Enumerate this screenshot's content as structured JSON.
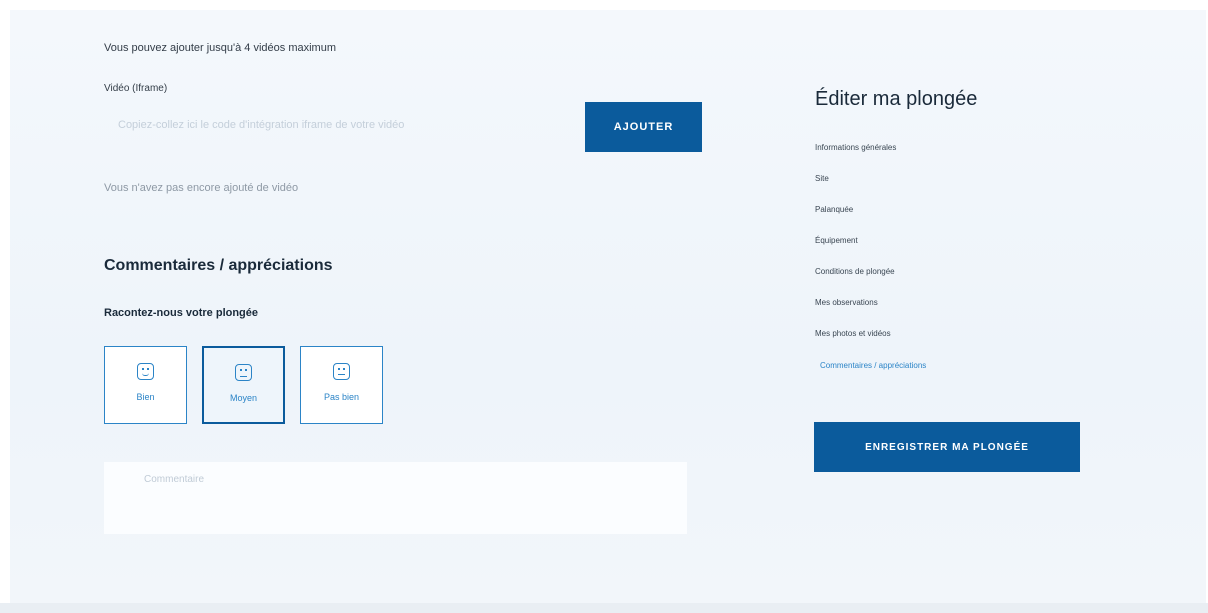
{
  "videos": {
    "limit_text": "Vous pouvez ajouter jusqu'à 4 vidéos maximum",
    "field_label": "Vidéo (Iframe)",
    "input_placeholder": "Copiez-collez ici le code d'intégration iframe de votre vidéo",
    "add_label": "AJOUTER",
    "empty_text": "Vous n'avez pas encore ajouté de vidéo"
  },
  "comments": {
    "section_title": "Commentaires / appréciations",
    "prompt": "Racontez-nous votre plongée",
    "ratings": [
      {
        "label": "Bien",
        "icon": "happy-face-icon"
      },
      {
        "label": "Moyen",
        "icon": "neutral-face-icon"
      },
      {
        "label": "Pas bien",
        "icon": "sad-face-icon"
      }
    ],
    "selected_rating": "Moyen",
    "comment_placeholder": "Commentaire"
  },
  "sidebar": {
    "title": "Éditer ma plongée",
    "items": [
      {
        "label": "Informations générales"
      },
      {
        "label": "Site"
      },
      {
        "label": "Palanquée"
      },
      {
        "label": "Équipement"
      },
      {
        "label": "Conditions de plongée"
      },
      {
        "label": "Mes observations"
      },
      {
        "label": "Mes photos et vidéos"
      },
      {
        "label": "Commentaires / appréciations"
      }
    ],
    "active_item": "Commentaires / appréciations",
    "save_label": "ENREGISTRER MA PLONGÉE"
  },
  "colors": {
    "accent": "#0b5b9c",
    "link": "#2b84c7"
  }
}
